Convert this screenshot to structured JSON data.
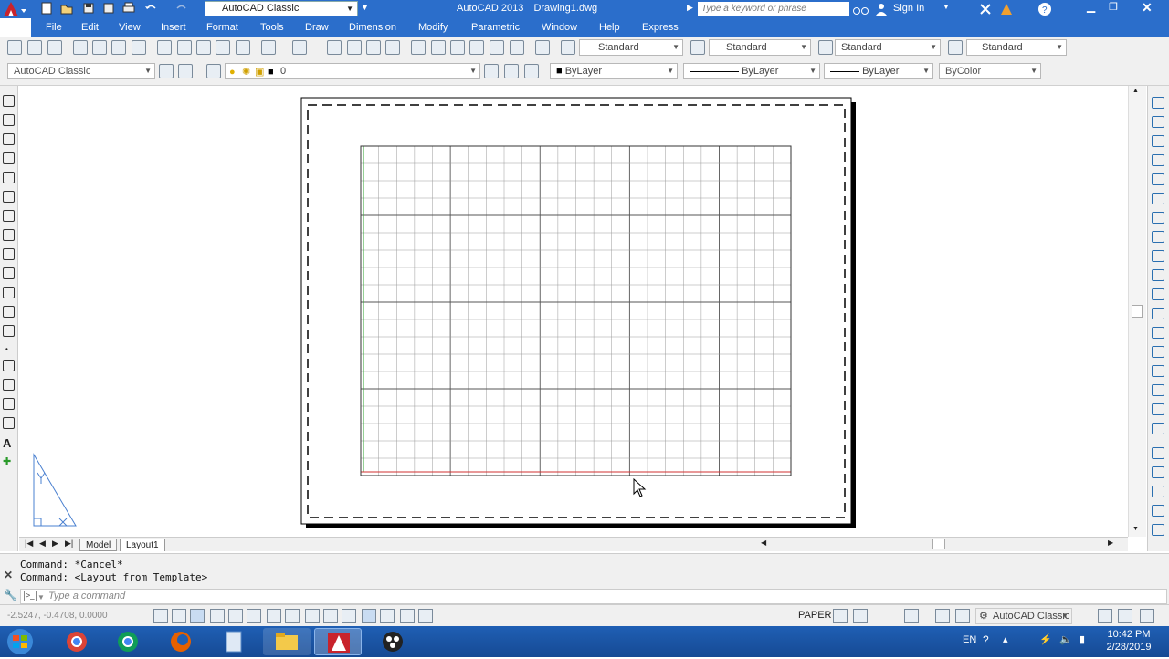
{
  "title_bar": {
    "workspace": "AutoCAD Classic",
    "app_title": "AutoCAD 2013",
    "document": "Drawing1.dwg",
    "search_placeholder": "Type a keyword or phrase",
    "sign_in": "Sign In"
  },
  "menu": [
    "File",
    "Edit",
    "View",
    "Insert",
    "Format",
    "Tools",
    "Draw",
    "Dimension",
    "Modify",
    "Parametric",
    "Window",
    "Help",
    "Express"
  ],
  "styles_toolbar": {
    "text_style": "Standard",
    "dim_style": "Standard",
    "table_style": "Standard",
    "multileader_style": "Standard"
  },
  "workspace_toolbar": {
    "workspace": "AutoCAD Classic",
    "layer": "0"
  },
  "properties_toolbar": {
    "color": "ByLayer",
    "linetype": "ByLayer",
    "lineweight": "ByLayer",
    "plot_style": "ByColor"
  },
  "layout_tabs": [
    "Model",
    "Layout1"
  ],
  "command_history": [
    "Command: *Cancel*",
    "Command:   <Layout from Template>"
  ],
  "command_placeholder": "Type a command",
  "status_bar": {
    "coordinates": "-2.5247, -0.4708, 0.0000",
    "space": "PAPER",
    "workspace": "AutoCAD Classic"
  },
  "taskbar": {
    "language": "EN",
    "time": "10:42 PM",
    "date": "2/28/2019"
  },
  "colors": {
    "title_blue": "#2b6ecb",
    "grid_line": "#9a9a9a",
    "x_axis": "#d23030",
    "y_axis": "#2ea02e"
  }
}
